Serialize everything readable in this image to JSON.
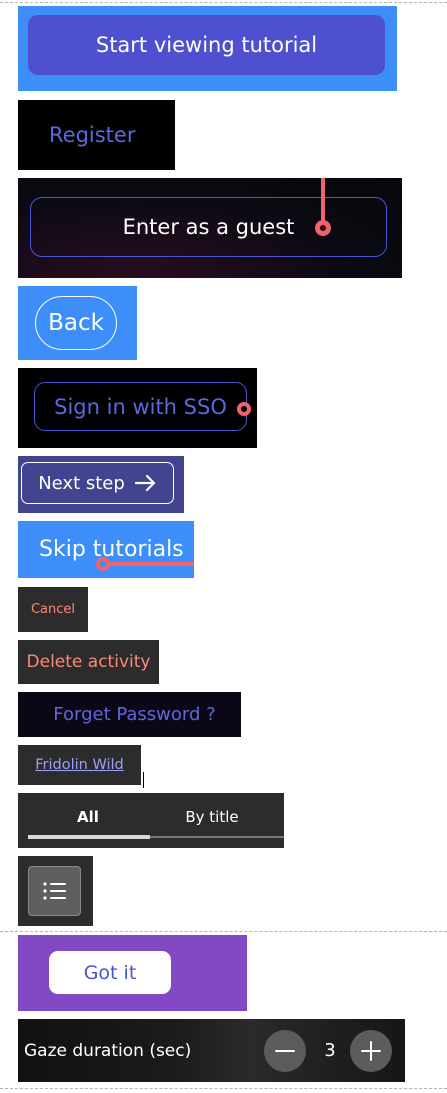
{
  "buttons": {
    "start_tutorial": "Start viewing tutorial",
    "register": "Register",
    "guest": "Enter as a guest",
    "back": "Back",
    "sso": "Sign in with SSO",
    "next_step": "Next step",
    "skip_tutorials": "Skip tutorials",
    "cancel": "Cancel",
    "delete_activity": "Delete activity",
    "forget_password": "Forget Password ?",
    "user_link": "Fridolin Wild",
    "got_it": "Got it"
  },
  "tabs": {
    "items": [
      {
        "label": "All",
        "selected": true
      },
      {
        "label": "By title",
        "selected": false
      }
    ]
  },
  "gaze": {
    "label": "Gaze duration (sec)",
    "value": "3"
  },
  "icons": {
    "next_arrow": "arrow-right-icon",
    "list_toggle": "list-icon",
    "decrement": "minus-icon",
    "increment": "plus-icon"
  },
  "colors": {
    "blue_panel": "#3d8ef8",
    "indigo_button": "#4f50d0",
    "accent_text": "#5e67e0",
    "danger_text": "#ff8879",
    "purple_panel": "#8349c4",
    "annotation_pink": "#f1626e"
  }
}
